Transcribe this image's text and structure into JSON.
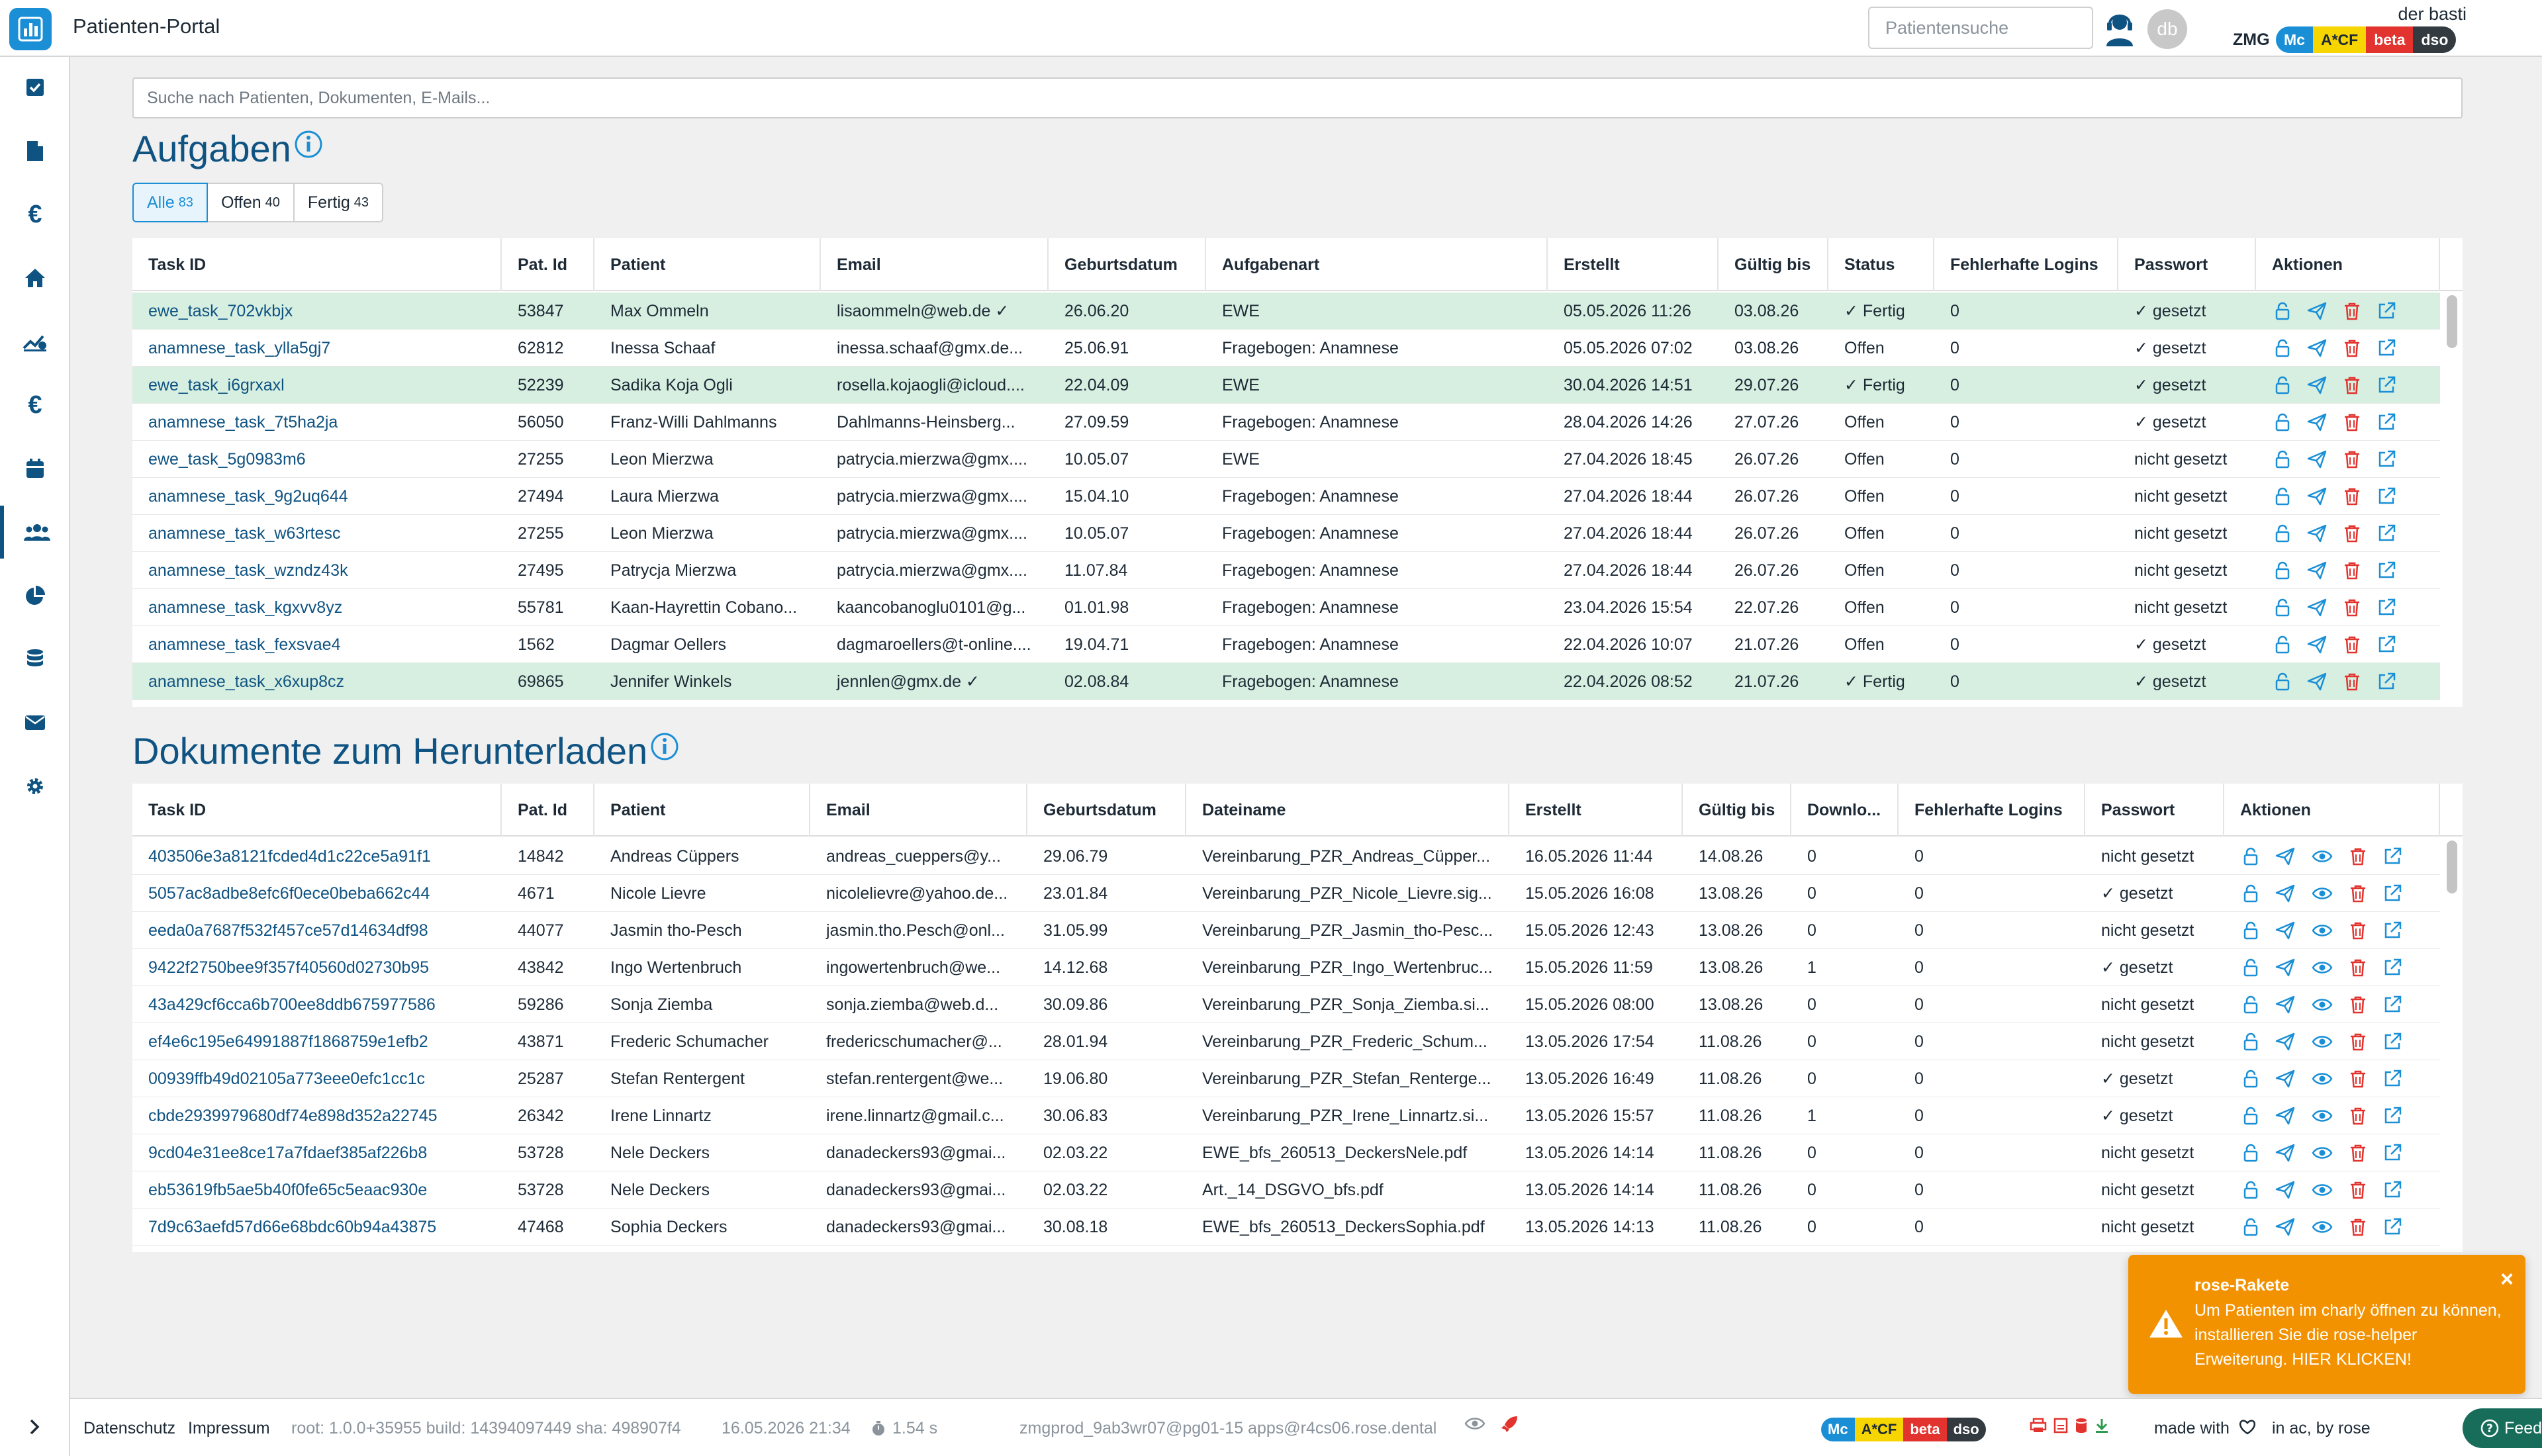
{
  "header": {
    "title": "Patienten-Portal",
    "search_placeholder": "Patientensuche",
    "avatar": "db",
    "user": "der basti",
    "tenant": "ZMG",
    "badges": [
      "Mc",
      "A*CF",
      "beta",
      "dso"
    ]
  },
  "colors": {
    "primary": "#0f5382",
    "accent": "#1a8fd6",
    "done_row": "#d7efe0",
    "danger": "#e2332e",
    "toast": "#f39200",
    "feedback": "#176d5a"
  },
  "sidebar": [
    "tasks-icon",
    "document-icon",
    "euro-icon",
    "home-icon",
    "stats-icon",
    "euro-icon",
    "calendar-icon",
    "users-icon",
    "pie-chart-icon",
    "database-icon",
    "mail-icon",
    "gear-icon"
  ],
  "global_search_placeholder": "Suche nach Patienten, Dokumenten, E-Mails...",
  "tasks": {
    "title": "Aufgaben",
    "tabs": [
      {
        "label": "Alle",
        "count": "83"
      },
      {
        "label": "Offen",
        "count": "40"
      },
      {
        "label": "Fertig",
        "count": "43"
      }
    ],
    "columns": [
      "Task ID",
      "Pat. Id",
      "Patient",
      "Email",
      "Geburtsdatum",
      "Aufgabenart",
      "Erstellt",
      "Gültig bis",
      "Status",
      "Fehlerhafte Logins",
      "Passwort",
      "Aktionen"
    ],
    "rows": [
      {
        "id": "ewe_task_702vkbjx",
        "pid": "53847",
        "patient": "Max Ommeln",
        "email": "lisaommeln@web.de ✓",
        "dob": "26.06.20",
        "type": "EWE",
        "created": "05.05.2026 11:26",
        "valid": "03.08.26",
        "status": "✓ Fertig",
        "logins": "0",
        "pw": "✓ gesetzt",
        "done": true
      },
      {
        "id": "anamnese_task_ylla5gj7",
        "pid": "62812",
        "patient": "Inessa Schaaf",
        "email": "inessa.schaaf@gmx.de...",
        "dob": "25.06.91",
        "type": "Fragebogen: Anamnese",
        "created": "05.05.2026 07:02",
        "valid": "03.08.26",
        "status": "Offen",
        "logins": "0",
        "pw": "✓ gesetzt",
        "done": false
      },
      {
        "id": "ewe_task_i6grxaxl",
        "pid": "52239",
        "patient": "Sadika Koja Ogli",
        "email": "rosella.kojaogli@icloud....",
        "dob": "22.04.09",
        "type": "EWE",
        "created": "30.04.2026 14:51",
        "valid": "29.07.26",
        "status": "✓ Fertig",
        "logins": "0",
        "pw": "✓ gesetzt",
        "done": true
      },
      {
        "id": "anamnese_task_7t5ha2ja",
        "pid": "56050",
        "patient": "Franz-Willi Dahlmanns",
        "email": "Dahlmanns-Heinsberg...",
        "dob": "27.09.59",
        "type": "Fragebogen: Anamnese",
        "created": "28.04.2026 14:26",
        "valid": "27.07.26",
        "status": "Offen",
        "logins": "0",
        "pw": "✓ gesetzt",
        "done": false
      },
      {
        "id": "ewe_task_5g0983m6",
        "pid": "27255",
        "patient": "Leon Mierzwa",
        "email": "patrycia.mierzwa@gmx....",
        "dob": "10.05.07",
        "type": "EWE",
        "created": "27.04.2026 18:45",
        "valid": "26.07.26",
        "status": "Offen",
        "logins": "0",
        "pw": "nicht gesetzt",
        "done": false
      },
      {
        "id": "anamnese_task_9g2uq644",
        "pid": "27494",
        "patient": "Laura Mierzwa",
        "email": "patrycia.mierzwa@gmx....",
        "dob": "15.04.10",
        "type": "Fragebogen: Anamnese",
        "created": "27.04.2026 18:44",
        "valid": "26.07.26",
        "status": "Offen",
        "logins": "0",
        "pw": "nicht gesetzt",
        "done": false
      },
      {
        "id": "anamnese_task_w63rtesc",
        "pid": "27255",
        "patient": "Leon Mierzwa",
        "email": "patrycia.mierzwa@gmx....",
        "dob": "10.05.07",
        "type": "Fragebogen: Anamnese",
        "created": "27.04.2026 18:44",
        "valid": "26.07.26",
        "status": "Offen",
        "logins": "0",
        "pw": "nicht gesetzt",
        "done": false
      },
      {
        "id": "anamnese_task_wzndz43k",
        "pid": "27495",
        "patient": "Patrycja Mierzwa",
        "email": "patrycia.mierzwa@gmx....",
        "dob": "11.07.84",
        "type": "Fragebogen: Anamnese",
        "created": "27.04.2026 18:44",
        "valid": "26.07.26",
        "status": "Offen",
        "logins": "0",
        "pw": "nicht gesetzt",
        "done": false
      },
      {
        "id": "anamnese_task_kgxvv8yz",
        "pid": "55781",
        "patient": "Kaan-Hayrettin Cobano...",
        "email": "kaancobanoglu0101@g...",
        "dob": "01.01.98",
        "type": "Fragebogen: Anamnese",
        "created": "23.04.2026 15:54",
        "valid": "22.07.26",
        "status": "Offen",
        "logins": "0",
        "pw": "nicht gesetzt",
        "done": false
      },
      {
        "id": "anamnese_task_fexsvae4",
        "pid": "1562",
        "patient": "Dagmar Oellers",
        "email": "dagmaroellers@t-online....",
        "dob": "19.04.71",
        "type": "Fragebogen: Anamnese",
        "created": "22.04.2026 10:07",
        "valid": "21.07.26",
        "status": "Offen",
        "logins": "0",
        "pw": "✓ gesetzt",
        "done": false
      },
      {
        "id": "anamnese_task_x6xup8cz",
        "pid": "69865",
        "patient": "Jennifer Winkels",
        "email": "jennlen@gmx.de ✓",
        "dob": "02.08.84",
        "type": "Fragebogen: Anamnese",
        "created": "22.04.2026 08:52",
        "valid": "21.07.26",
        "status": "✓ Fertig",
        "logins": "0",
        "pw": "✓ gesetzt",
        "done": true
      }
    ]
  },
  "documents": {
    "title": "Dokumente zum Herunterladen",
    "columns": [
      "Task ID",
      "Pat. Id",
      "Patient",
      "Email",
      "Geburtsdatum",
      "Dateiname",
      "Erstellt",
      "Gültig bis",
      "Downlo...",
      "Fehlerhafte Logins",
      "Passwort",
      "Aktionen"
    ],
    "rows": [
      {
        "id": "403506e3a8121fcded4d1c22ce5a91f1",
        "pid": "14842",
        "patient": "Andreas Cüppers",
        "email": "andreas_cueppers@y...",
        "dob": "29.06.79",
        "file": "Vereinbarung_PZR_Andreas_Cüpper...",
        "created": "16.05.2026 11:44",
        "valid": "14.08.26",
        "dl": "0",
        "logins": "0",
        "pw": "nicht gesetzt"
      },
      {
        "id": "5057ac8adbe8efc6f0ece0beba662c44",
        "pid": "4671",
        "patient": "Nicole Lievre",
        "email": "nicolelievre@yahoo.de...",
        "dob": "23.01.84",
        "file": "Vereinbarung_PZR_Nicole_Lievre.sig...",
        "created": "15.05.2026 16:08",
        "valid": "13.08.26",
        "dl": "0",
        "logins": "0",
        "pw": "✓ gesetzt"
      },
      {
        "id": "eeda0a7687f532f457ce57d14634df98",
        "pid": "44077",
        "patient": "Jasmin tho-Pesch",
        "email": "jasmin.tho.Pesch@onl...",
        "dob": "31.05.99",
        "file": "Vereinbarung_PZR_Jasmin_tho-Pesc...",
        "created": "15.05.2026 12:43",
        "valid": "13.08.26",
        "dl": "0",
        "logins": "0",
        "pw": "nicht gesetzt"
      },
      {
        "id": "9422f2750bee9f357f40560d02730b95",
        "pid": "43842",
        "patient": "Ingo Wertenbruch",
        "email": "ingowertenbruch@we...",
        "dob": "14.12.68",
        "file": "Vereinbarung_PZR_Ingo_Wertenbruc...",
        "created": "15.05.2026 11:59",
        "valid": "13.08.26",
        "dl": "1",
        "logins": "0",
        "pw": "✓ gesetzt"
      },
      {
        "id": "43a429cf6cca6b700ee8ddb675977586",
        "pid": "59286",
        "patient": "Sonja Ziemba",
        "email": "sonja.ziemba@web.d...",
        "dob": "30.09.86",
        "file": "Vereinbarung_PZR_Sonja_Ziemba.si...",
        "created": "15.05.2026 08:00",
        "valid": "13.08.26",
        "dl": "0",
        "logins": "0",
        "pw": "nicht gesetzt"
      },
      {
        "id": "ef4e6c195e64991887f1868759e1efb2",
        "pid": "43871",
        "patient": "Frederic Schumacher",
        "email": "fredericschumacher@...",
        "dob": "28.01.94",
        "file": "Vereinbarung_PZR_Frederic_Schum...",
        "created": "13.05.2026 17:54",
        "valid": "11.08.26",
        "dl": "0",
        "logins": "0",
        "pw": "nicht gesetzt"
      },
      {
        "id": "00939ffb49d02105a773eee0efc1cc1c",
        "pid": "25287",
        "patient": "Stefan Rentergent",
        "email": "stefan.rentergent@we...",
        "dob": "19.06.80",
        "file": "Vereinbarung_PZR_Stefan_Renterge...",
        "created": "13.05.2026 16:49",
        "valid": "11.08.26",
        "dl": "0",
        "logins": "0",
        "pw": "✓ gesetzt"
      },
      {
        "id": "cbde2939979680df74e898d352a22745",
        "pid": "26342",
        "patient": "Irene Linnartz",
        "email": "irene.linnartz@gmail.c...",
        "dob": "30.06.83",
        "file": "Vereinbarung_PZR_Irene_Linnartz.si...",
        "created": "13.05.2026 15:57",
        "valid": "11.08.26",
        "dl": "1",
        "logins": "0",
        "pw": "✓ gesetzt"
      },
      {
        "id": "9cd04e31ee8ce17a7fdaef385af226b8",
        "pid": "53728",
        "patient": "Nele Deckers",
        "email": "danadeckers93@gmai...",
        "dob": "02.03.22",
        "file": "EWE_bfs_260513_DeckersNele.pdf",
        "created": "13.05.2026 14:14",
        "valid": "11.08.26",
        "dl": "0",
        "logins": "0",
        "pw": "nicht gesetzt"
      },
      {
        "id": "eb53619fb5ae5b40f0fe65c5eaac930e",
        "pid": "53728",
        "patient": "Nele Deckers",
        "email": "danadeckers93@gmai...",
        "dob": "02.03.22",
        "file": "Art._14_DSGVO_bfs.pdf",
        "created": "13.05.2026 14:14",
        "valid": "11.08.26",
        "dl": "0",
        "logins": "0",
        "pw": "nicht gesetzt"
      },
      {
        "id": "7d9c63aefd57d66e68bdc60b94a43875",
        "pid": "47468",
        "patient": "Sophia Deckers",
        "email": "danadeckers93@gmai...",
        "dob": "30.08.18",
        "file": "EWE_bfs_260513_DeckersSophia.pdf",
        "created": "13.05.2026 14:13",
        "valid": "11.08.26",
        "dl": "0",
        "logins": "0",
        "pw": "nicht gesetzt"
      }
    ]
  },
  "toast": {
    "title": "rose-Rakete",
    "body": "Um Patienten im charly öffnen zu können, installieren Sie die rose-helper Erweiterung. HIER KLICKEN!",
    "close": "×"
  },
  "footer": {
    "privacy": "Datenschutz",
    "imprint": "Impressum",
    "version": "root: 1.0.0+35955 build: 14394097449 sha: 498907f4",
    "date": "16.05.2026 21:34",
    "timing": "1.54 s",
    "server": "zmgprod_9ab3wr07@pg01-15 apps@r4cs06.rose.dental",
    "badges": [
      "Mc",
      "A*CF",
      "beta",
      "dso"
    ],
    "made_with": "made with",
    "made_by": "in ac, by rose",
    "feedback": "Feedback"
  }
}
